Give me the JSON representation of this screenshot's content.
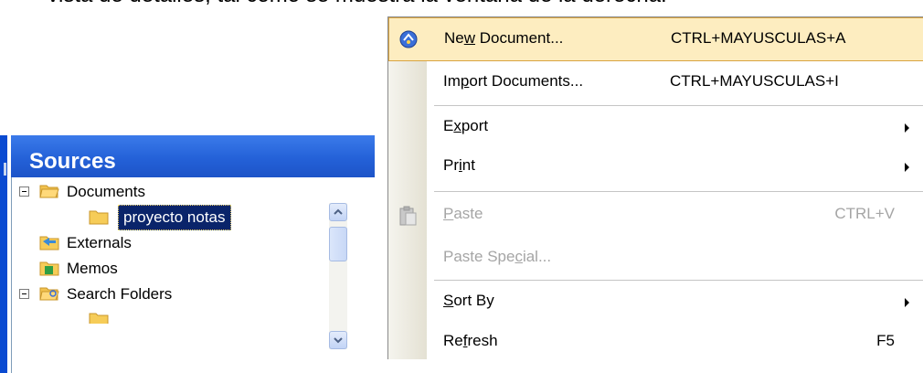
{
  "caption": "vista de detalles, tal como se muestra la ventana de la derecha.",
  "sources": {
    "title": "Sources",
    "tree": [
      {
        "label": "Documents"
      },
      {
        "label": "proyecto notas"
      },
      {
        "label": "Externals"
      },
      {
        "label": "Memos"
      },
      {
        "label": "Search Folders"
      }
    ]
  },
  "menu": {
    "items": [
      {
        "pre": "Ne",
        "ul": "w",
        "post": " Document...",
        "shortcut": "CTRL+MAYUSCULAS+A",
        "icon": "new-document-icon"
      },
      {
        "pre": "Im",
        "ul": "p",
        "post": "ort Documents...",
        "shortcut": "CTRL+MAYUSCULAS+I"
      },
      {
        "pre": "E",
        "ul": "x",
        "post": "port"
      },
      {
        "pre": "Pr",
        "ul": "i",
        "post": "nt"
      },
      {
        "pre": "",
        "ul": "P",
        "post": "aste",
        "shortcut": "CTRL+V",
        "icon": "paste-icon"
      },
      {
        "pre": "Paste Spe",
        "ul": "c",
        "post": "ial..."
      },
      {
        "pre": "",
        "ul": "S",
        "post": "ort By"
      },
      {
        "pre": "Re",
        "ul": "f",
        "post": "resh",
        "shortcut": "F5"
      }
    ]
  },
  "colors": {
    "header_blue": "#2461d8",
    "menu_highlight": "#fdedc0",
    "selection": "#0a246a"
  }
}
